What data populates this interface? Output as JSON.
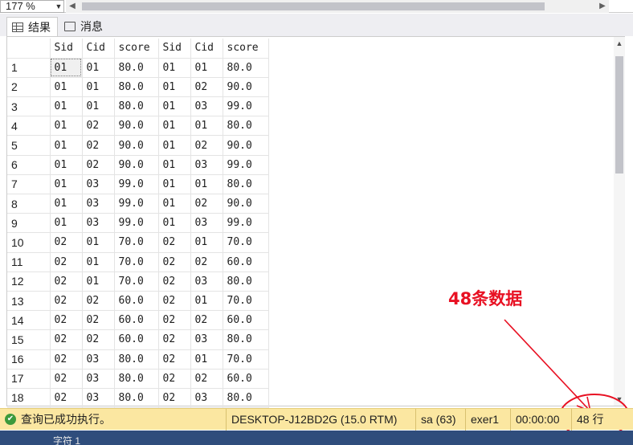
{
  "zoom": {
    "value": "177 %"
  },
  "tabs": [
    {
      "label": "结果",
      "icon": "grid-icon"
    },
    {
      "label": "消息",
      "icon": "message-icon"
    }
  ],
  "grid": {
    "columns": [
      "Sid",
      "Cid",
      "score",
      "Sid",
      "Cid",
      "score"
    ],
    "rows": [
      [
        "1",
        "01",
        "01",
        "80.0",
        "01",
        "01",
        "80.0"
      ],
      [
        "2",
        "01",
        "01",
        "80.0",
        "01",
        "02",
        "90.0"
      ],
      [
        "3",
        "01",
        "01",
        "80.0",
        "01",
        "03",
        "99.0"
      ],
      [
        "4",
        "01",
        "02",
        "90.0",
        "01",
        "01",
        "80.0"
      ],
      [
        "5",
        "01",
        "02",
        "90.0",
        "01",
        "02",
        "90.0"
      ],
      [
        "6",
        "01",
        "02",
        "90.0",
        "01",
        "03",
        "99.0"
      ],
      [
        "7",
        "01",
        "03",
        "99.0",
        "01",
        "01",
        "80.0"
      ],
      [
        "8",
        "01",
        "03",
        "99.0",
        "01",
        "02",
        "90.0"
      ],
      [
        "9",
        "01",
        "03",
        "99.0",
        "01",
        "03",
        "99.0"
      ],
      [
        "10",
        "02",
        "01",
        "70.0",
        "02",
        "01",
        "70.0"
      ],
      [
        "11",
        "02",
        "01",
        "70.0",
        "02",
        "02",
        "60.0"
      ],
      [
        "12",
        "02",
        "01",
        "70.0",
        "02",
        "03",
        "80.0"
      ],
      [
        "13",
        "02",
        "02",
        "60.0",
        "02",
        "01",
        "70.0"
      ],
      [
        "14",
        "02",
        "02",
        "60.0",
        "02",
        "02",
        "60.0"
      ],
      [
        "15",
        "02",
        "02",
        "60.0",
        "02",
        "03",
        "80.0"
      ],
      [
        "16",
        "02",
        "03",
        "80.0",
        "02",
        "01",
        "70.0"
      ],
      [
        "17",
        "02",
        "03",
        "80.0",
        "02",
        "02",
        "60.0"
      ],
      [
        "18",
        "02",
        "03",
        "80.0",
        "02",
        "03",
        "80.0"
      ]
    ]
  },
  "annotation": {
    "text": "48条数据",
    "color": "#e81123"
  },
  "status": {
    "message": "查询已成功执行。",
    "server": "DESKTOP-J12BD2G (15.0 RTM)",
    "user": "sa (63)",
    "database": "exer1",
    "elapsed": "00:00:00",
    "rows": "48 行",
    "bg_color": "#fbe7a1"
  },
  "bottom": {
    "text": "字符 1"
  }
}
